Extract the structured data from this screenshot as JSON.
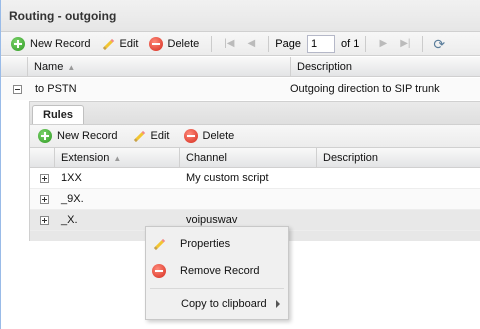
{
  "panel": {
    "title": "Routing - outgoing"
  },
  "toolbar": {
    "new_record": "New Record",
    "edit": "Edit",
    "delete": "Delete",
    "page_label": "Page",
    "page_value": "1",
    "of_label": "of 1"
  },
  "columns": {
    "name": "Name",
    "description": "Description"
  },
  "row": {
    "name": "to PSTN",
    "description": "Outgoing direction to SIP trunk"
  },
  "sub": {
    "tab": "Rules",
    "new_record": "New Record",
    "edit": "Edit",
    "delete": "Delete",
    "columns": {
      "extension": "Extension",
      "channel": "Channel",
      "description": "Description"
    },
    "rows": [
      {
        "extension": "1XX",
        "channel": "My custom script",
        "description": ""
      },
      {
        "extension": "_9X.",
        "channel": "",
        "description": ""
      },
      {
        "extension": "_X.",
        "channel": "voipuswav",
        "description": ""
      }
    ]
  },
  "context_menu": {
    "properties": "Properties",
    "remove": "Remove Record",
    "copy": "Copy to clipboard"
  }
}
